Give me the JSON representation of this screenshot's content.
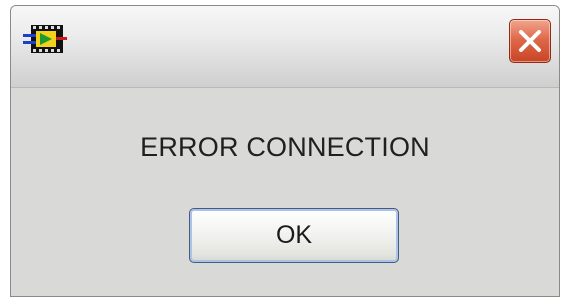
{
  "dialog": {
    "icon": "labview-vi-icon",
    "close_icon": "close-icon",
    "message": "ERROR CONNECTION",
    "ok_label": "OK"
  },
  "colors": {
    "close_button": "#d9573a",
    "dialog_background": "#d9d9d7"
  }
}
